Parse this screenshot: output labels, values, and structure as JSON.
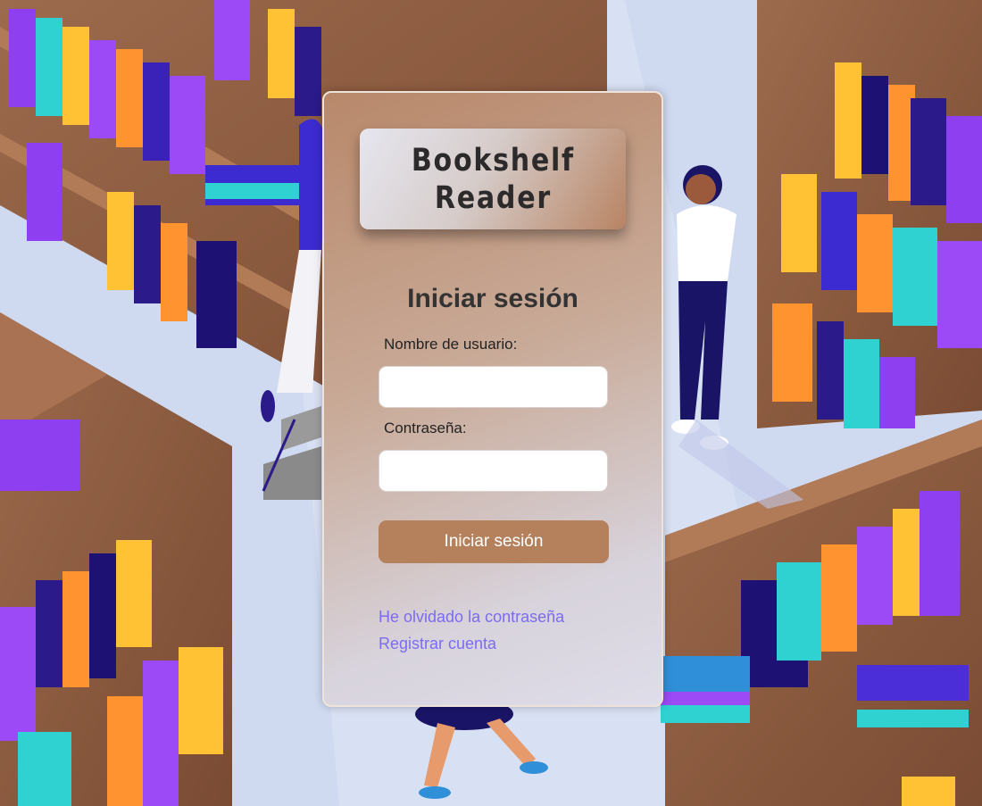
{
  "app": {
    "logo_text": "Bookshelf\nReader"
  },
  "login": {
    "title": "Iniciar sesión",
    "username_label": "Nombre de usuario:",
    "username_value": "",
    "password_label": "Contraseña:",
    "password_value": "",
    "submit_label": "Iniciar sesión",
    "forgot_link": "He olvidado la contraseña",
    "register_link": "Registrar cuenta"
  },
  "colors": {
    "accent": "#b5815d",
    "link": "#7b6cf0",
    "background": "#cfd9ef"
  },
  "background_image": "isometric-library-illustration"
}
